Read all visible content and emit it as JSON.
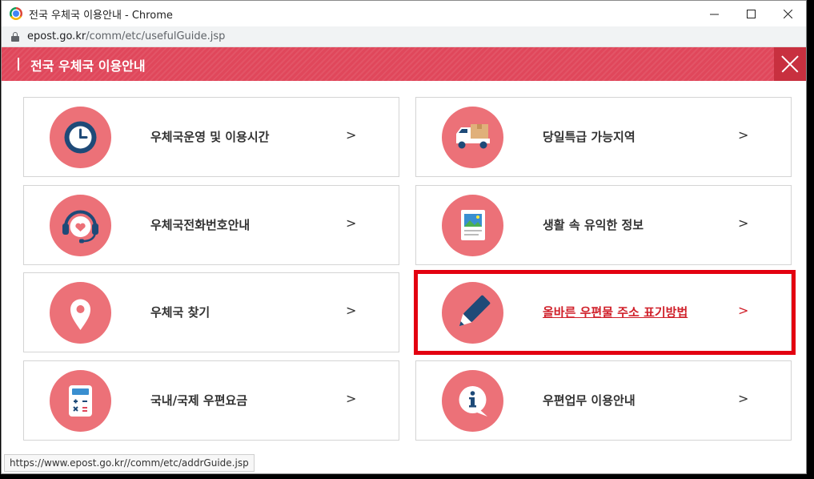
{
  "window": {
    "title": "전국 우체국 이용안내 - Chrome"
  },
  "address": {
    "host": "epost.go.kr",
    "path": "/comm/etc/usefulGuide.jsp"
  },
  "header": {
    "title": "전국 우체국 이용안내"
  },
  "cards": [
    {
      "label": "우체국운영 및 이용시간",
      "icon": "clock-icon"
    },
    {
      "label": "당일특급 가능지역",
      "icon": "delivery-truck-icon"
    },
    {
      "label": "우체국전화번호안내",
      "icon": "headset-icon"
    },
    {
      "label": "생활 속 유익한 정보",
      "icon": "picture-document-icon"
    },
    {
      "label": "우체국 찾기",
      "icon": "location-pin-icon"
    },
    {
      "label": "올바른 우편물 주소 표기방법",
      "icon": "pencil-icon"
    },
    {
      "label": "국내/국제 우편요금",
      "icon": "calculator-icon"
    },
    {
      "label": "우편업무 이용안내",
      "icon": "info-icon"
    }
  ],
  "arrow": ">",
  "statusbar": {
    "url": "https://www.epost.go.kr//comm/etc/addrGuide.jsp"
  },
  "colors": {
    "header": "#e0475b",
    "icon_circle": "#ec7178",
    "icon_dark": "#1e4a78",
    "highlight": "#e30010"
  }
}
